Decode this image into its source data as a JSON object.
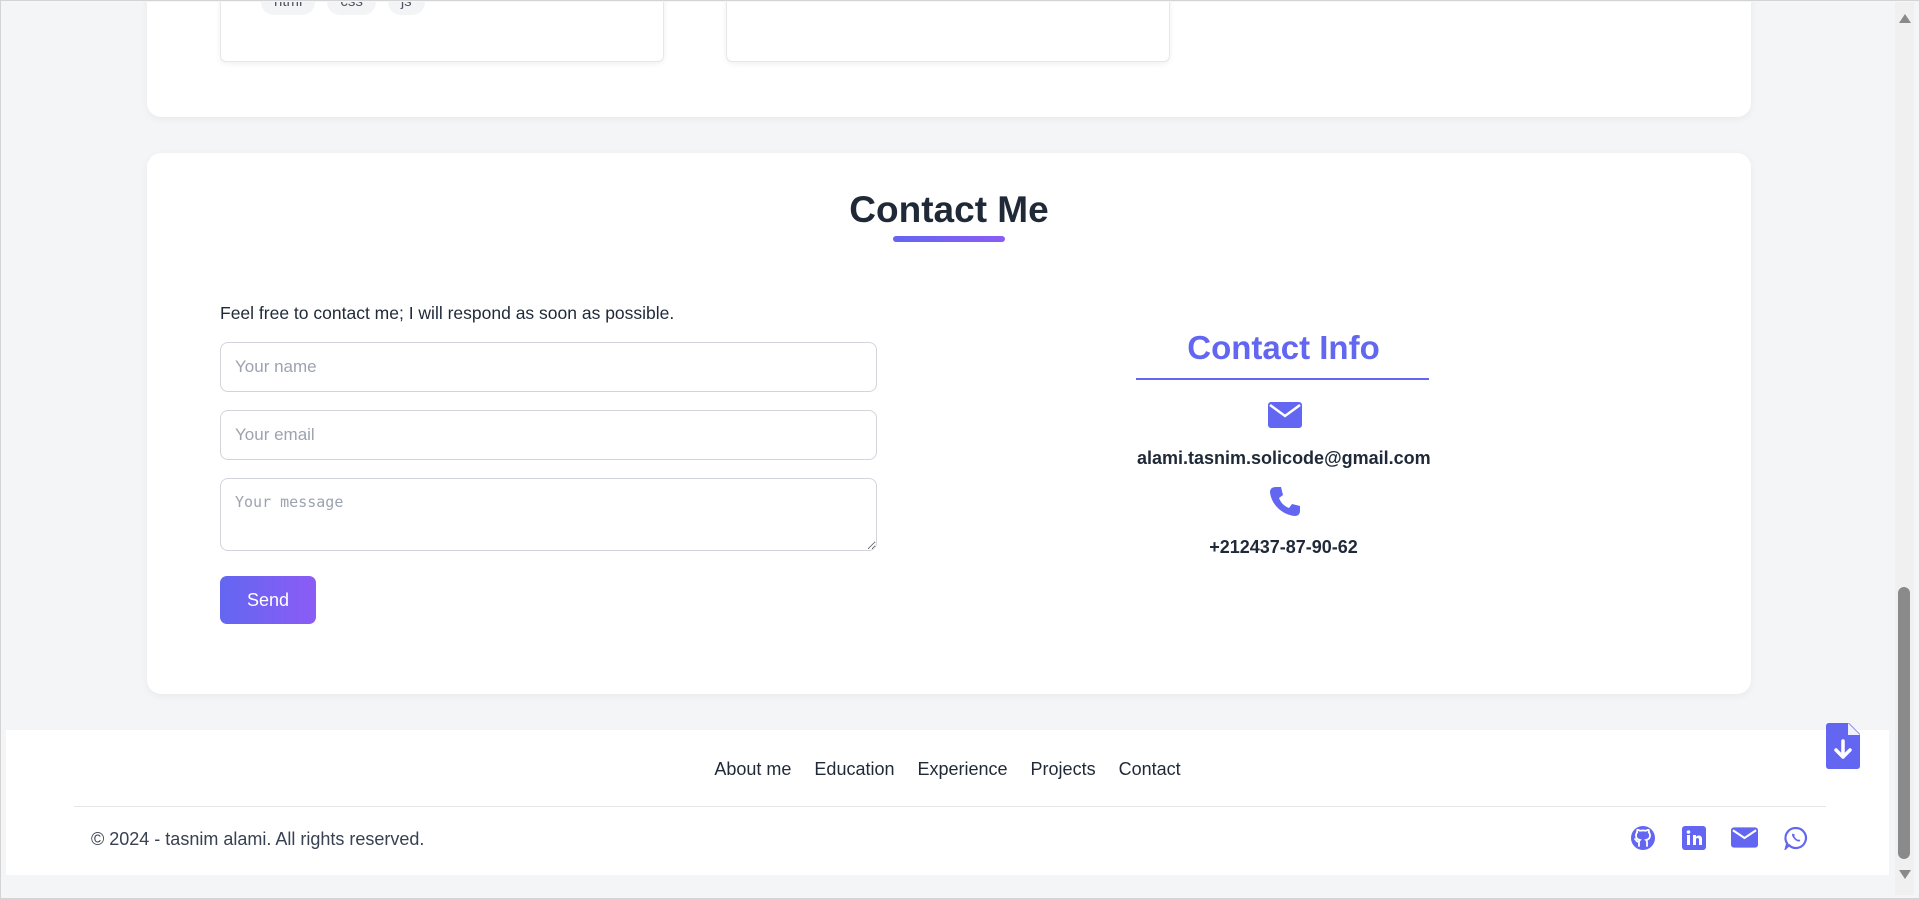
{
  "projects": {
    "card1_tags": [
      "html",
      "css",
      "js"
    ]
  },
  "contact": {
    "title": "Contact Me",
    "intro": "Feel free to contact me; I will respond as soon as possible.",
    "name_placeholder": "Your name",
    "email_placeholder": "Your email",
    "message_placeholder": "Your message",
    "send_label": "Send",
    "info": {
      "title": "Contact Info",
      "email_icon": "envelope-icon",
      "email": "alami.tasnim.solicode@gmail.com",
      "phone_icon": "phone-icon",
      "phone": "+212437-87-90-62"
    }
  },
  "footer": {
    "nav": [
      "About me",
      "Education",
      "Experience",
      "Projects",
      "Contact"
    ],
    "copyright": "© 2024 - tasnim alami. All rights reserved.",
    "social_icons": [
      "github-icon",
      "linkedin-icon",
      "envelope-icon",
      "whatsapp-icon"
    ]
  },
  "colors": {
    "accent": "#6366f1",
    "accent_gradient_end": "#8b5cf6",
    "text": "#1f2937"
  }
}
